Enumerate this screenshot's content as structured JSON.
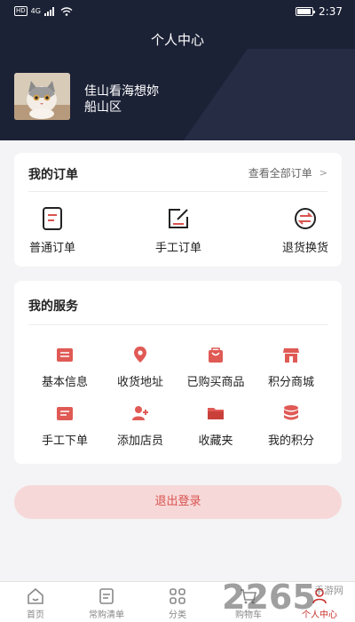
{
  "status_bar": {
    "network": "4G",
    "hd": "HD",
    "time": "2:37",
    "battery_level": 0.95
  },
  "header": {
    "title": "个人中心",
    "username": "佳山看海想妳",
    "district": "船山区"
  },
  "orders": {
    "title": "我的订单",
    "view_all": "查看全部订单",
    "items": [
      {
        "label": "普通订单",
        "icon": "document-icon"
      },
      {
        "label": "手工订单",
        "icon": "edit-icon"
      },
      {
        "label": "退货换货",
        "icon": "exchange-icon"
      }
    ]
  },
  "services": {
    "title": "我的服务",
    "items": [
      {
        "label": "基本信息",
        "icon": "info-card-icon"
      },
      {
        "label": "收货地址",
        "icon": "location-pin-icon"
      },
      {
        "label": "已购买商品",
        "icon": "shopping-bag-icon"
      },
      {
        "label": "积分商城",
        "icon": "store-icon"
      },
      {
        "label": "手工下单",
        "icon": "manual-order-icon"
      },
      {
        "label": "添加店员",
        "icon": "add-user-icon"
      },
      {
        "label": "收藏夹",
        "icon": "folder-icon"
      },
      {
        "label": "我的积分",
        "icon": "coins-icon"
      }
    ]
  },
  "logout_label": "退出登录",
  "tabbar": {
    "items": [
      {
        "label": "首页",
        "icon": "home-icon"
      },
      {
        "label": "常购清单",
        "icon": "list-icon"
      },
      {
        "label": "分类",
        "icon": "grid-icon"
      },
      {
        "label": "购物车",
        "icon": "cart-icon"
      },
      {
        "label": "个人中心",
        "icon": "person-icon"
      }
    ],
    "active": "个人中心"
  },
  "watermark": {
    "number": "2265",
    "text": "手游网"
  },
  "colors": {
    "header_bg": "#1c2236",
    "accent": "#d9534f",
    "logout_bg": "#f7d8d8"
  }
}
